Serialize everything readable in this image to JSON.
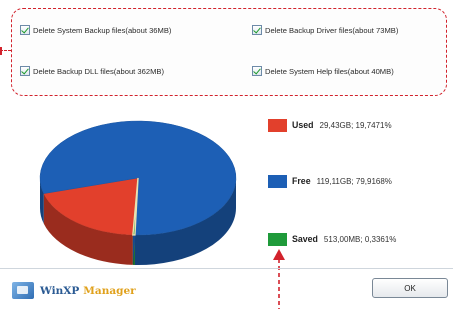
{
  "options": [
    {
      "label": "Delete System Backup files(about 36MB)",
      "checked": true
    },
    {
      "label": "Delete Backup Driver files(about 73MB)",
      "checked": true
    },
    {
      "label": "Delete Backup DLL files(about 362MB)",
      "checked": true
    },
    {
      "label": "Delete System Help files(about 40MB)",
      "checked": true
    }
  ],
  "legend": [
    {
      "name": "Used",
      "value": "29,43GB; 19,7471%",
      "color": "#e2402c"
    },
    {
      "name": "Free",
      "value": "119,11GB; 79,9168%",
      "color": "#1d5fb5"
    },
    {
      "name": "Saved",
      "value": "513,00MB; 0,3361%",
      "color": "#1f9a3a"
    }
  ],
  "chart_data": {
    "type": "pie",
    "categories": [
      "Used",
      "Free",
      "Saved"
    ],
    "values": [
      19.7471,
      79.9168,
      0.3361
    ],
    "colors": [
      "#e2402c",
      "#1d5fb5",
      "#1f9a3a"
    ]
  },
  "logo": {
    "brand": "WinXP",
    "suffix": "Manager"
  },
  "ok_label": "OK",
  "annotation_color": "#d2222c"
}
